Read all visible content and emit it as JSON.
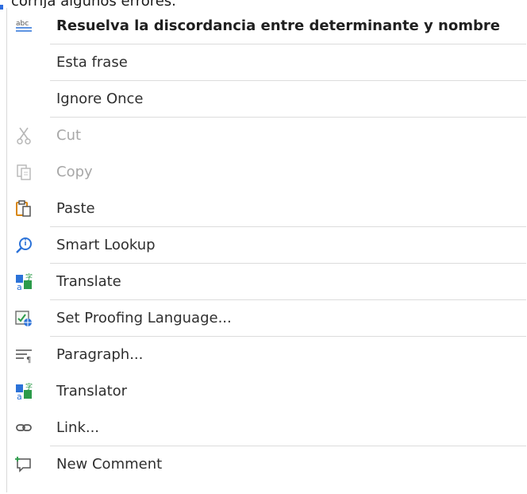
{
  "background_text": {
    "visible_text": "corrija algunos errores."
  },
  "menu": {
    "items": [
      {
        "label": "Resuelva la discordancia entre determinante y nombre",
        "icon": "spelling-abc-icon",
        "state": "emphasized"
      },
      {
        "label": "Esta frase",
        "icon": "none",
        "state": "normal"
      },
      {
        "label": "Ignore Once",
        "icon": "none",
        "state": "normal"
      },
      {
        "label": "Cut",
        "icon": "scissors-icon",
        "state": "disabled"
      },
      {
        "label": "Copy",
        "icon": "copy-icon",
        "state": "disabled"
      },
      {
        "label": "Paste",
        "icon": "paste-icon",
        "state": "normal"
      },
      {
        "label": "Smart Lookup",
        "icon": "search-icon",
        "state": "normal"
      },
      {
        "label": "Translate",
        "icon": "translate-icon",
        "state": "normal"
      },
      {
        "label": "Set Proofing Language...",
        "icon": "proofing-language-icon",
        "state": "normal"
      },
      {
        "label": "Paragraph...",
        "icon": "paragraph-icon",
        "state": "normal"
      },
      {
        "label": "Translator",
        "icon": "translator-icon",
        "state": "normal"
      },
      {
        "label": "Link...",
        "icon": "link-icon",
        "state": "normal"
      },
      {
        "label": "New Comment",
        "icon": "new-comment-icon",
        "state": "normal"
      }
    ]
  },
  "colors": {
    "menu_background": "#ffffff",
    "text": "#2f2f2f",
    "disabled_text": "#a7a7a7",
    "separator": "#dcdcdc",
    "blue_icon": "#2b72d8",
    "green_icon": "#2c9b4a",
    "orange_icon": "#d88713"
  }
}
